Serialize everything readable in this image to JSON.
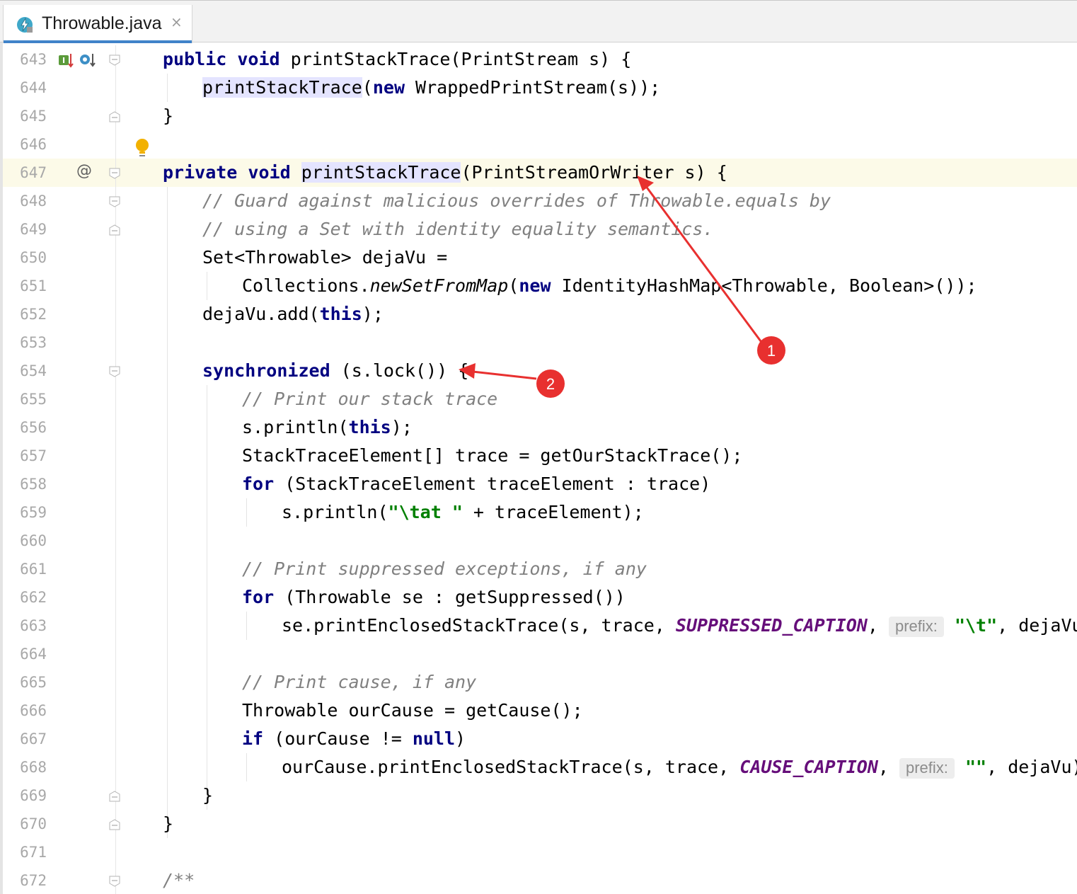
{
  "tab": {
    "title": "Throwable.java",
    "close_glyph": "×",
    "icon": "java-class-icon"
  },
  "gutter_markers": {
    "implements_icon": "I",
    "at_sign": "@"
  },
  "lines": [
    {
      "n": "643"
    },
    {
      "n": "644"
    },
    {
      "n": "645"
    },
    {
      "n": "646"
    },
    {
      "n": "647"
    },
    {
      "n": "648"
    },
    {
      "n": "649"
    },
    {
      "n": "650"
    },
    {
      "n": "651"
    },
    {
      "n": "652"
    },
    {
      "n": "653"
    },
    {
      "n": "654"
    },
    {
      "n": "655"
    },
    {
      "n": "656"
    },
    {
      "n": "657"
    },
    {
      "n": "658"
    },
    {
      "n": "659"
    },
    {
      "n": "660"
    },
    {
      "n": "661"
    },
    {
      "n": "662"
    },
    {
      "n": "663"
    },
    {
      "n": "664"
    },
    {
      "n": "665"
    },
    {
      "n": "666"
    },
    {
      "n": "667"
    },
    {
      "n": "668"
    },
    {
      "n": "669"
    },
    {
      "n": "670"
    },
    {
      "n": "671"
    },
    {
      "n": "672"
    }
  ],
  "code": {
    "l643": {
      "kw1": "public",
      "kw2": "void",
      "rest": " printStackTrace(PrintStream s) {"
    },
    "l644": {
      "call": "printStackTrace",
      "open": "(",
      "kw": "new",
      "rest": " WrappedPrintStream(s));"
    },
    "l645": {
      "text": "}"
    },
    "l647": {
      "kw1": "private",
      "kw2": "void",
      "name": "printStackTrace",
      "rest": "(PrintStreamOrWriter s) {"
    },
    "l648": {
      "comment": "// Guard against malicious overrides of Throwable.equals by"
    },
    "l649": {
      "comment": "// using a Set with identity equality semantics."
    },
    "l650": {
      "text": "Set<Throwable> dejaVu ="
    },
    "l651": {
      "pre": "Collections.",
      "method": "newSetFromMap",
      "open": "(",
      "kw": "new",
      "rest": " IdentityHashMap<Throwable, Boolean>());"
    },
    "l652": {
      "pre": "dejaVu.add(",
      "kw": "this",
      "rest": ");"
    },
    "l654": {
      "kw": "synchronized",
      "rest": " (s.lock()) {"
    },
    "l655": {
      "comment": "// Print our stack trace"
    },
    "l656": {
      "pre": "s.println(",
      "kw": "this",
      "rest": ");"
    },
    "l657": {
      "text": "StackTraceElement[] trace = getOurStackTrace();"
    },
    "l658": {
      "kw": "for",
      "rest": " (StackTraceElement traceElement : trace)"
    },
    "l659": {
      "pre": "s.println(",
      "str": "\"\\tat \"",
      "rest": " + traceElement);"
    },
    "l661": {
      "comment": "// Print suppressed exceptions, if any"
    },
    "l662": {
      "kw": "for",
      "rest": " (Throwable se : getSuppressed())"
    },
    "l663": {
      "pre": "se.printEnclosedStackTrace(s, trace, ",
      "field": "SUPPRESSED_CAPTION",
      "comma": ", ",
      "hint": "prefix:",
      "str": "\"\\t\"",
      "rest": ", dejaVu);"
    },
    "l665": {
      "comment": "// Print cause, if any"
    },
    "l666": {
      "text": "Throwable ourCause = getCause();"
    },
    "l667": {
      "kw1": "if",
      "mid": " (ourCause != ",
      "kw2": "null",
      "rest": ")"
    },
    "l668": {
      "pre": "ourCause.printEnclosedStackTrace(s, trace, ",
      "field": "CAUSE_CAPTION",
      "comma": ", ",
      "hint": "prefix:",
      "str": "\"\"",
      "rest": ", dejaVu);"
    },
    "l669": {
      "text": "}"
    },
    "l670": {
      "text": "}"
    },
    "l672": {
      "comment": "/**"
    }
  },
  "annotations": [
    {
      "label": "1",
      "color": "#e8302f"
    },
    {
      "label": "2",
      "color": "#e8302f"
    }
  ],
  "colors": {
    "keyword": "#000080",
    "comment": "#808080",
    "string": "#008000",
    "field": "#660e7a",
    "current_line": "#fcfae8",
    "usage_highlight": "#e4e4ff",
    "annotation": "#e8302f",
    "tab_underline": "#4083c9"
  }
}
